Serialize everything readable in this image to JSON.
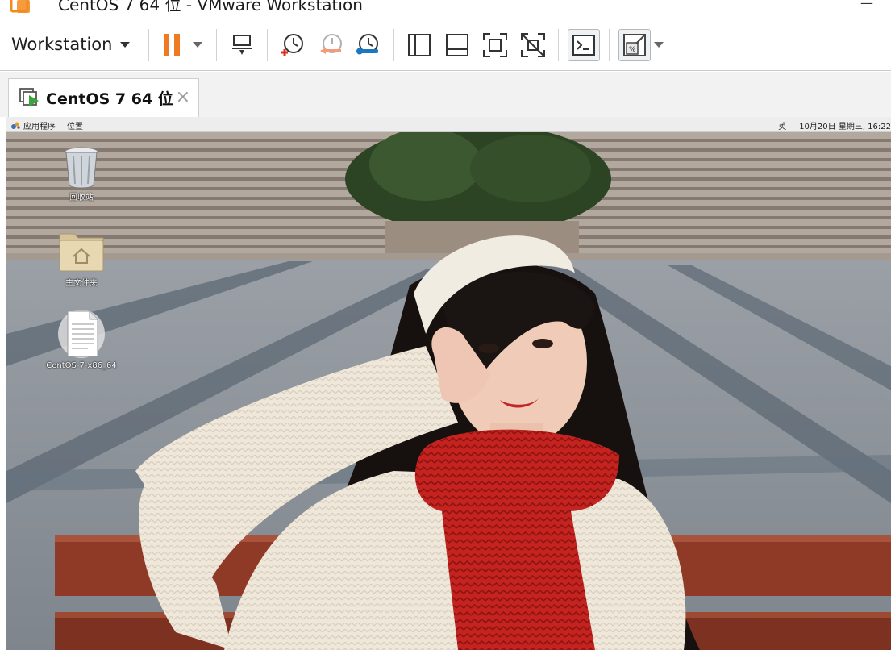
{
  "window": {
    "title": "CentOS 7 64 位 - VMware Workstation",
    "controls": "—"
  },
  "toolbar": {
    "menu_label": "Workstation"
  },
  "tabs": [
    {
      "label": "CentOS 7 64 位",
      "close": "×"
    }
  ],
  "guest_panel": {
    "applications": "应用程序",
    "places": "位置",
    "input_method": "英",
    "datetime": "10月20日 星期三, 16:22"
  },
  "desktop": {
    "icons": [
      {
        "label": "回收站",
        "icon": "trash-icon"
      },
      {
        "label": "主文件夹",
        "icon": "home-folder-icon"
      },
      {
        "label": "CentOS-7-x86_64",
        "icon": "document-icon"
      }
    ]
  },
  "colors": {
    "pause_orange": "#f07a22",
    "snapshot_red": "#e0301e",
    "snapshot_blue": "#1a78c2",
    "play_green": "#3aa53a"
  }
}
